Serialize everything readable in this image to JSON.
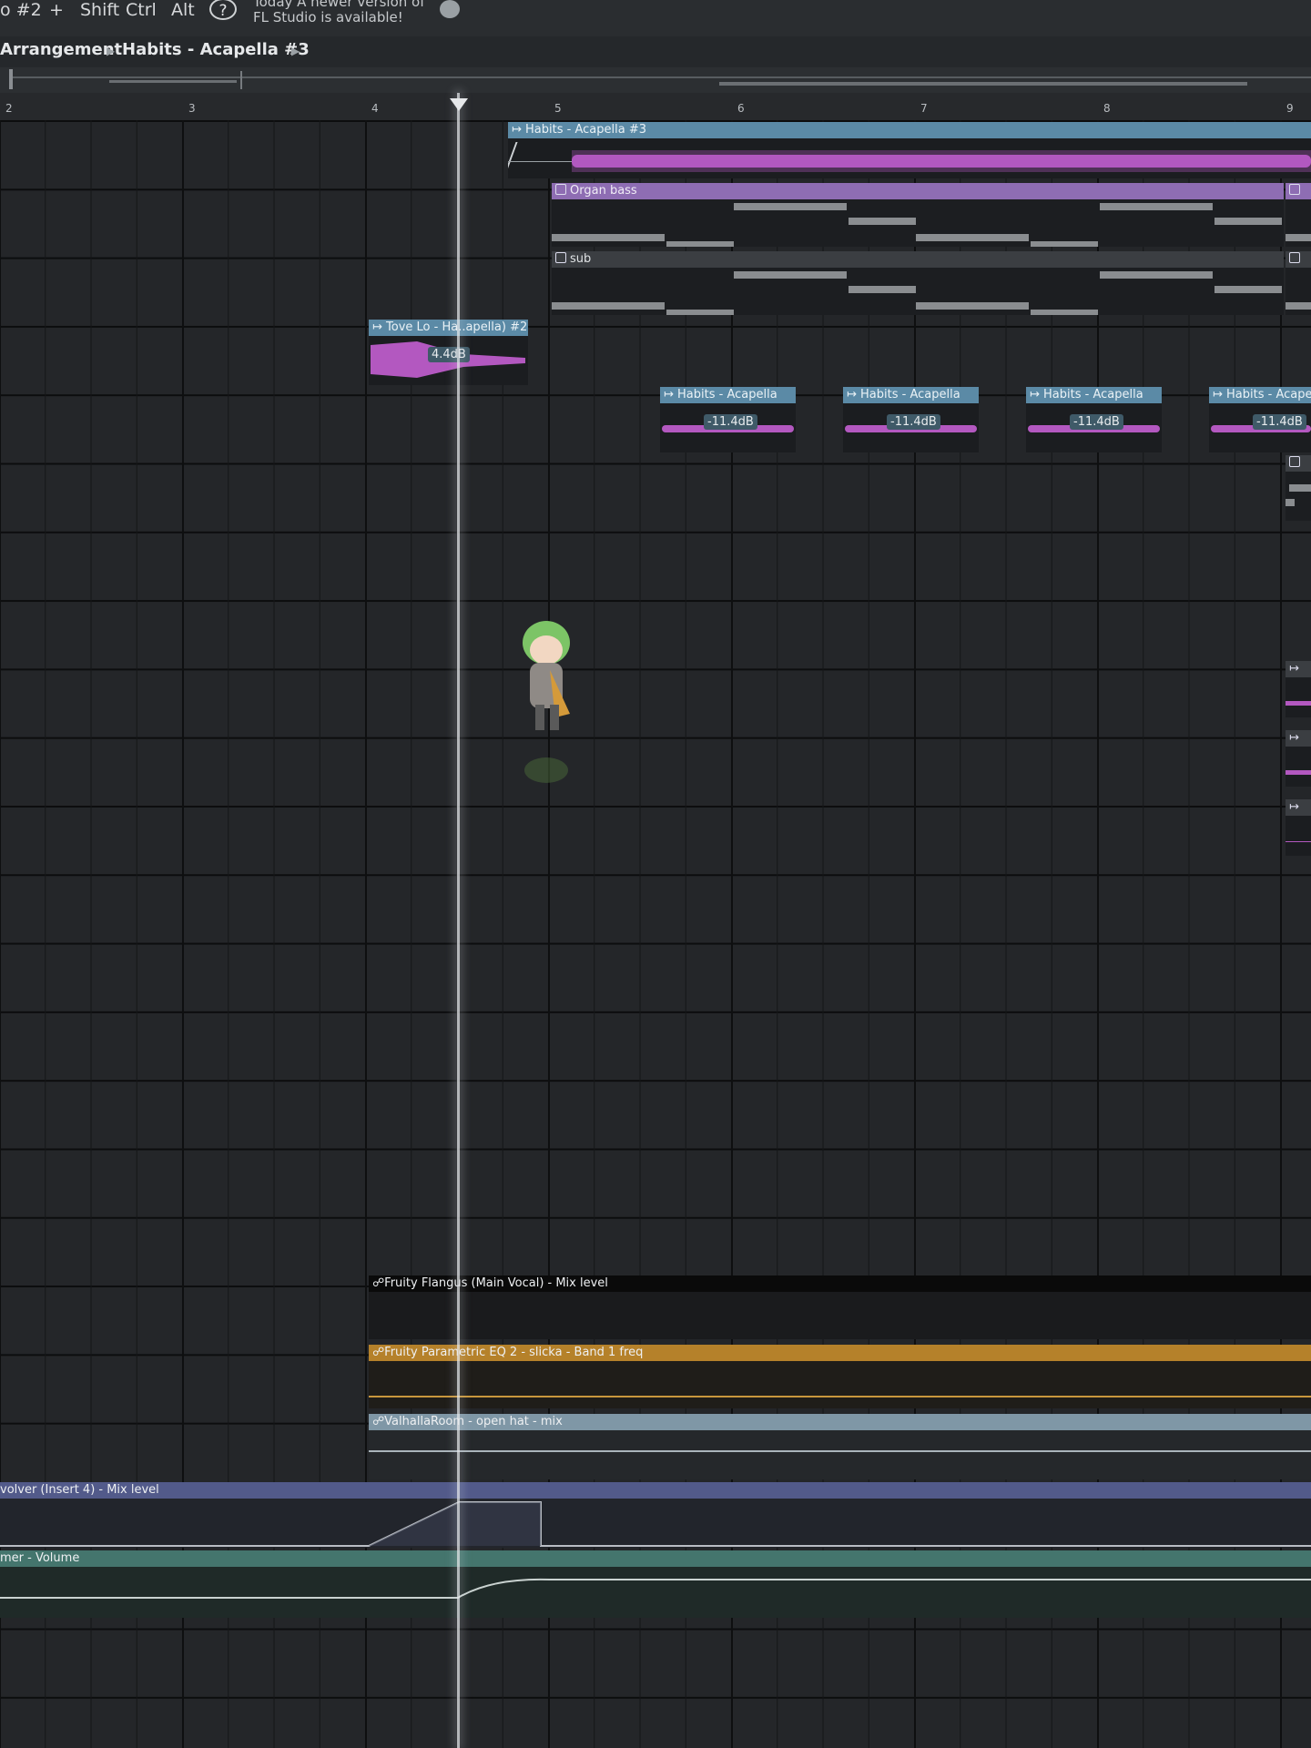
{
  "toolbar": {
    "pattern_label": "o #2",
    "plus_label": "+",
    "shift_label": "Shift",
    "ctrl_label": "Ctrl",
    "alt_label": "Alt",
    "help_label": "?",
    "hint_line1": "Today  A newer version of",
    "hint_line2": "FL Studio is available!"
  },
  "breadcrumb": {
    "root": "Arrangement",
    "current": "Habits - Acapella #3"
  },
  "ruler": {
    "bars": [
      "2",
      "3",
      "4",
      "5",
      "6",
      "7",
      "8",
      "9"
    ]
  },
  "clips": {
    "habits_main": "Habits - Acapella #3",
    "organ_bass": "Organ bass",
    "sub": "sub",
    "tove_lo": "Tove Lo - Ha..apella) #2",
    "tove_lo_vol": "4.4dB",
    "habits_short": "Habits - Acapella",
    "habits_short_vol": "-11.4dB"
  },
  "automation": {
    "flangus": "Fruity Flangus (Main Vocal) - Mix level",
    "param_eq": "Fruity Parametric EQ 2 - slicka - Band 1 freq",
    "valhalla": "ValhallaRoom - open hat - mix",
    "convolver": "volver (Insert 4) - Mix level",
    "volume": "mer - Volume"
  },
  "colors": {
    "audio_header": "#5b8aa6",
    "pattern_header": "#8e6db3",
    "sub_header": "#3b3e42",
    "waveform": "#b358c0",
    "flangus_header": "#0a0a0a",
    "eq_header": "#b5812a",
    "valhalla_header": "#7f97a6",
    "convolver_header": "#525a8a",
    "volume_header": "#44756d"
  },
  "icons": {
    "audio_clip": "audio-clip-icon",
    "pattern_clip": "pattern-clip-icon",
    "automation_clip": "automation-clip-icon"
  }
}
